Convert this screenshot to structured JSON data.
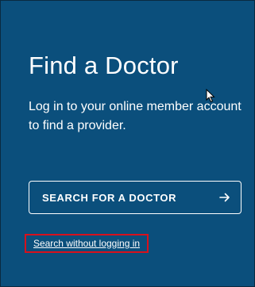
{
  "card": {
    "title": "Find a Doctor",
    "description": "Log in to your online member account to find a provider."
  },
  "search_button": {
    "label": "SEARCH FOR A DOCTOR",
    "icon": "arrow-right-icon"
  },
  "guest_link": {
    "label": "Search without logging in"
  },
  "colors": {
    "background": "#0b4f7c",
    "text": "#ffffff",
    "highlight": "#d8111c"
  }
}
